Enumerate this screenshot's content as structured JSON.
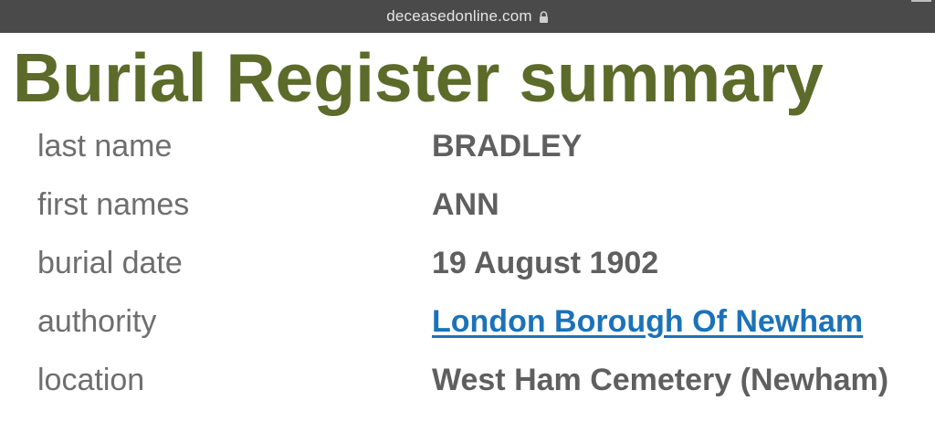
{
  "browser": {
    "url": "deceasedonline.com",
    "lock_icon": "lock-icon"
  },
  "page": {
    "title": "Burial Register summary"
  },
  "summary": {
    "rows": [
      {
        "label": "last name",
        "value": "BRADLEY"
      },
      {
        "label": "first names",
        "value": "ANN"
      },
      {
        "label": "burial date",
        "value": "19 August 1902"
      },
      {
        "label": "authority",
        "value": "London Borough Of Newham"
      },
      {
        "label": "location",
        "value": "West Ham Cemetery (Newham)"
      }
    ]
  },
  "colors": {
    "title": "#5c6b2a",
    "label": "#6e6e6e",
    "value": "#5f5f5f",
    "link": "#1c72b8",
    "url_bar": "#4a4a4a"
  }
}
